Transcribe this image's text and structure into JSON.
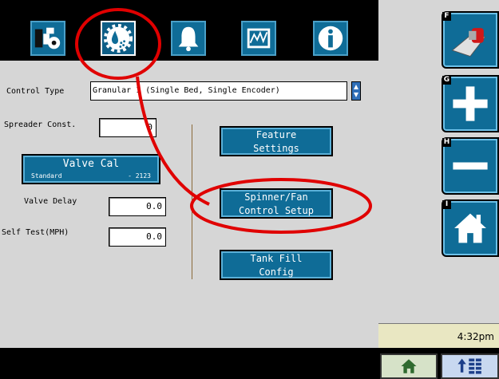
{
  "tabs": [
    {
      "name": "machine-settings-tab",
      "icon": "machine-icon"
    },
    {
      "name": "application-settings-tab",
      "icon": "gear-droplet-icon",
      "active": true
    },
    {
      "name": "alarms-tab",
      "icon": "bell-icon"
    },
    {
      "name": "diagnostics-tab",
      "icon": "graph-icon"
    },
    {
      "name": "info-tab",
      "icon": "info-icon"
    }
  ],
  "control_type": {
    "label": "Control Type",
    "value": "Granular 1 (Single Bed, Single Encoder)"
  },
  "spreader_const": {
    "label": "Spreader Const.",
    "value": "0"
  },
  "valve_cal": {
    "title": "Valve Cal",
    "mode": "Standard",
    "value": "- 2123"
  },
  "valve_delay": {
    "label": "Valve Delay",
    "value": "0.0"
  },
  "self_test": {
    "label": "Self Test(MPH)",
    "value": "0.0"
  },
  "buttons": {
    "feature_settings": [
      "Feature",
      "Settings"
    ],
    "spinner_fan": [
      "Spinner/Fan",
      "Control Setup"
    ],
    "tank_fill": [
      "Tank Fill",
      "Config"
    ]
  },
  "softkeys": [
    {
      "letter": "F",
      "icon": "toggle-switch-icon"
    },
    {
      "letter": "G",
      "icon": "plus-icon"
    },
    {
      "letter": "H",
      "icon": "minus-icon"
    },
    {
      "letter": "I",
      "icon": "home-icon"
    }
  ],
  "clock": "4:32pm",
  "colors": {
    "button_blue": "#0f6c97",
    "panel_gray": "#d6d6d6",
    "annotation_red": "#e00000"
  }
}
